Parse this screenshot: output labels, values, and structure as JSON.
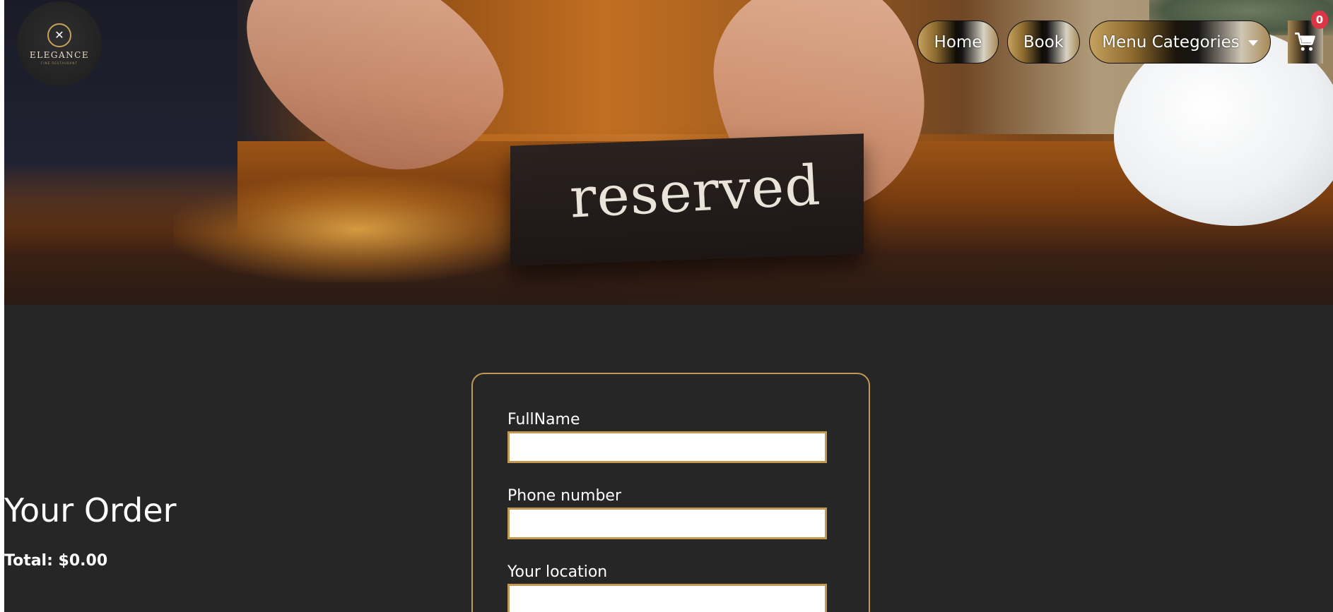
{
  "hero": {
    "sign_text": "reserved"
  },
  "brand": {
    "name": "ELEGANCE",
    "tagline": "FINE RESTAURANT",
    "accent_color": "#c39a53"
  },
  "nav": {
    "home_label": "Home",
    "book_label": "Book",
    "menu_categories_label": "Menu Categories"
  },
  "cart": {
    "icon": "shopping-cart-icon",
    "count": "0",
    "badge_color": "#dc3545"
  },
  "order": {
    "title": "Your Order",
    "total": "Total: $0.00"
  },
  "form": {
    "fields": [
      {
        "label": "FullName",
        "value": "",
        "placeholder": ""
      },
      {
        "label": "Phone number",
        "value": "",
        "placeholder": ""
      },
      {
        "label": "Your location",
        "value": "",
        "placeholder": ""
      }
    ]
  }
}
